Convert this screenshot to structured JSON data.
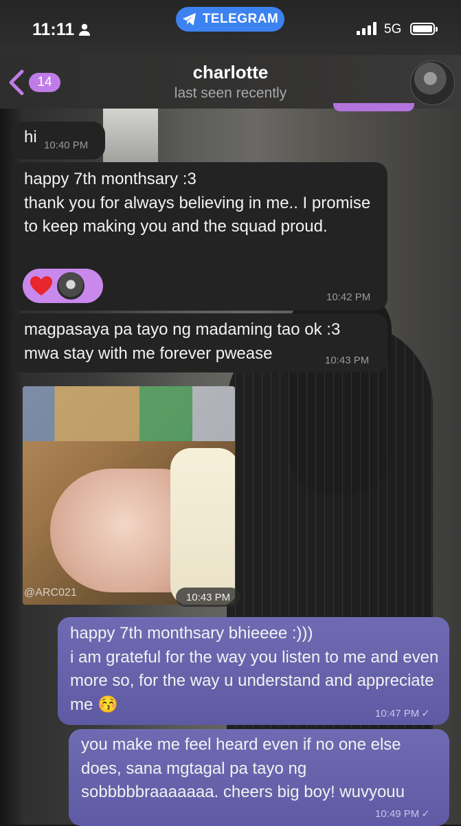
{
  "status_bar": {
    "time": "11:11",
    "app_pill": "TELEGRAM",
    "network": "5G"
  },
  "header": {
    "back_count": "14",
    "title": "charlotte",
    "subtitle": "last seen recently"
  },
  "messages": [
    {
      "text": "hi",
      "time": "10:40 PM"
    },
    {
      "text": "happy 7th monthsary :3\nthank you for always believing in me.. I promise to keep making you and the squad proud.",
      "time": "10:42 PM",
      "reaction": "❤️"
    },
    {
      "text": "magpasaya pa tayo ng madaming tao ok :3\nmwa stay with me forever pwease",
      "time": "10:43 PM"
    },
    {
      "photo_watermark": "@ARC021",
      "time": "10:43 PM"
    },
    {
      "text": "happy 7th monthsary bhieeee :)))\ni am grateful for the way you listen to me and even more so, for the way u understand and appreciate me 😚",
      "time": "10:47 PM",
      "status": "✓"
    },
    {
      "text": "you make me feel heard even if no one else does, sana mgtagal pa tayo ng sobbbbbraaaaaaa. cheers big boy! wuvyouu",
      "time": "10:49 PM",
      "status": "✓"
    }
  ],
  "colors": {
    "incoming_bubble": "#232323",
    "outgoing_bubble": "#6a66ad",
    "accent": "#c07ce6",
    "telegram_blue": "#3c82f0"
  },
  "icons": [
    "person-icon",
    "telegram-plane-icon",
    "signal-icon",
    "battery-icon",
    "back-chevron-icon",
    "heart-icon",
    "read-check-icon"
  ]
}
